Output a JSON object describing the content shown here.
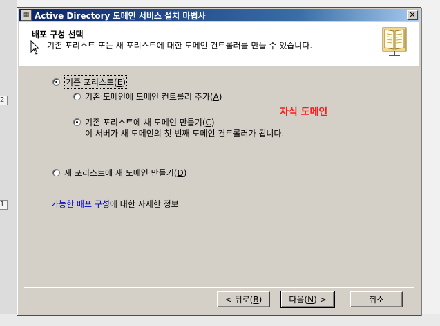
{
  "window": {
    "title": "Active Directory 도메인 서비스 설치 마법사",
    "close_glyph": "✕"
  },
  "header": {
    "title": "배포 구성 선택",
    "description": "기존 포리스트 또는 새 포리스트에 대한 도메인 컨트롤러를 만들 수 있습니다."
  },
  "options": {
    "existing_forest": {
      "label": "기존 포리스트(",
      "key": "E",
      "close": ")",
      "checked": true
    },
    "add_dc": {
      "label": "기존 도메인에 도메인 컨트롤러 추가(",
      "key": "A",
      "close": ")",
      "checked": false
    },
    "new_domain": {
      "label": "기존 포리스트에 새 도메인 만들기(",
      "key": "C",
      "close": ")",
      "checked": true,
      "note": "이 서버가 새 도메인의 첫 번째 도메인 컨트롤러가 됩니다."
    },
    "new_forest": {
      "label": "새 포리스트에 새 도메인 만들기(",
      "key": "D",
      "close": ")",
      "checked": false
    }
  },
  "annotation": "자식 도메인",
  "info": {
    "link_text": "가능한 배포 구성",
    "suffix": "에 대한 자세한 정보"
  },
  "buttons": {
    "back": {
      "prefix": "< 뒤로(",
      "key": "B",
      "suffix": ")"
    },
    "next": {
      "prefix": "다음(",
      "key": "N",
      "suffix": ") >"
    },
    "cancel": "취소"
  },
  "background": {
    "marker_top": "2",
    "marker_bottom": "1"
  },
  "icons": {
    "app": "app-icon",
    "book": "book-icon",
    "cursor": "mouse-cursor-icon"
  }
}
